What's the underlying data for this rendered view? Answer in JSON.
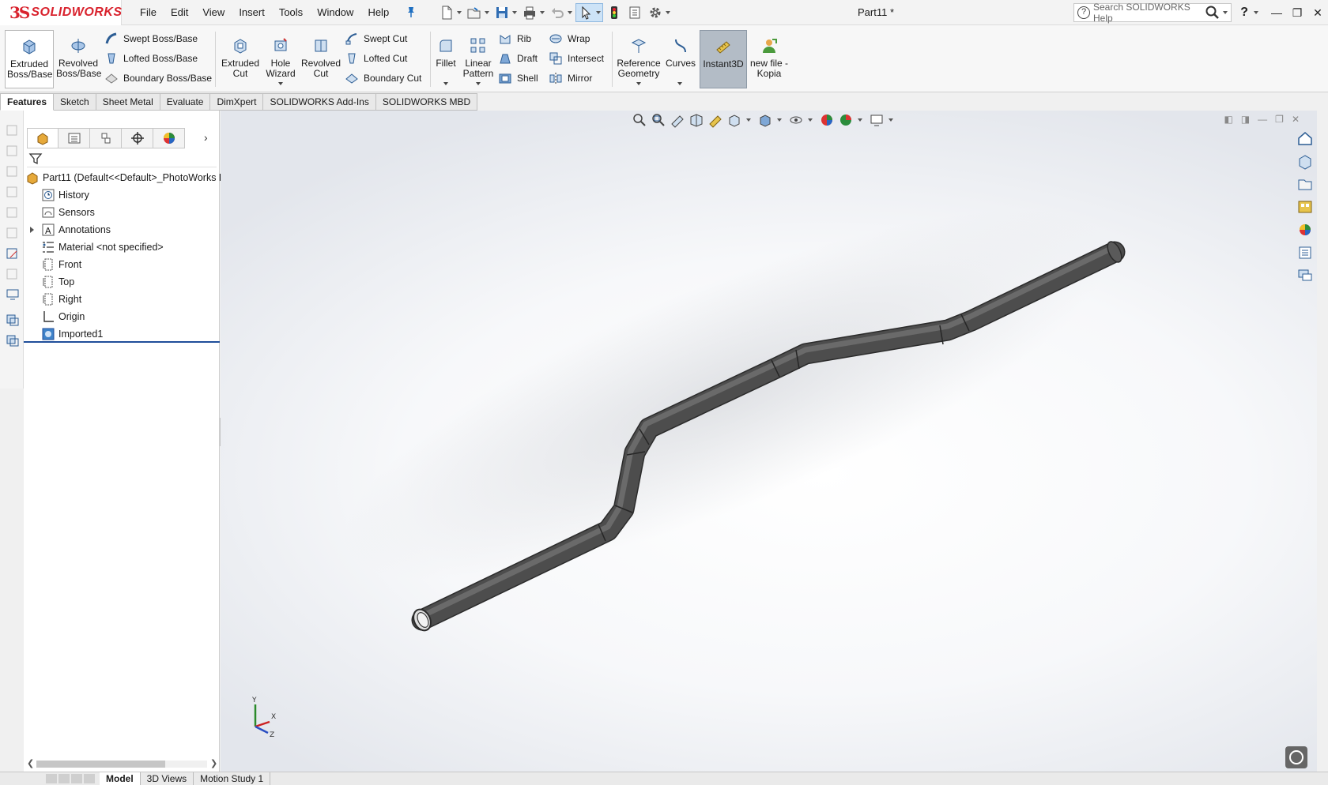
{
  "app": {
    "brand_ds": "3S",
    "brand_name": "SOLIDWORKS",
    "document_title": "Part11 *"
  },
  "menu": [
    "File",
    "Edit",
    "View",
    "Insert",
    "Tools",
    "Window",
    "Help"
  ],
  "search": {
    "placeholder": "Search SOLIDWORKS Help"
  },
  "toolbar": {
    "extruded_boss": "Extruded Boss/Base",
    "revolved_boss": "Revolved Boss/Base",
    "swept_boss": "Swept Boss/Base",
    "lofted_boss": "Lofted Boss/Base",
    "boundary_boss": "Boundary Boss/Base",
    "extruded_cut": "Extruded Cut",
    "hole_wizard": "Hole Wizard",
    "revolved_cut": "Revolved Cut",
    "swept_cut": "Swept Cut",
    "lofted_cut": "Lofted Cut",
    "boundary_cut": "Boundary Cut",
    "fillet": "Fillet",
    "linear_pattern": "Linear Pattern",
    "rib": "Rib",
    "draft": "Draft",
    "shell": "Shell",
    "wrap": "Wrap",
    "intersect": "Intersect",
    "mirror": "Mirror",
    "reference_geometry": "Reference Geometry",
    "curves": "Curves",
    "instant3d": "Instant3D",
    "new_file_kopia": "new file - Kopia"
  },
  "tabs": [
    "Features",
    "Sketch",
    "Sheet Metal",
    "Evaluate",
    "DimXpert",
    "SOLIDWORKS Add-Ins",
    "SOLIDWORKS MBD"
  ],
  "active_tab": "Features",
  "tree": {
    "root": "Part11  (Default<<Default>_PhotoWorks D",
    "items": [
      {
        "label": "History",
        "icon": "history-icon"
      },
      {
        "label": "Sensors",
        "icon": "sensors-icon"
      },
      {
        "label": "Annotations",
        "icon": "annotations-icon"
      },
      {
        "label": "Material <not specified>",
        "icon": "material-icon"
      },
      {
        "label": "Front",
        "icon": "plane-icon"
      },
      {
        "label": "Top",
        "icon": "plane-icon"
      },
      {
        "label": "Right",
        "icon": "plane-icon"
      },
      {
        "label": "Origin",
        "icon": "origin-icon"
      },
      {
        "label": "Imported1",
        "icon": "imported-body-icon"
      }
    ]
  },
  "triad": {
    "x": "X",
    "y": "Y",
    "z": "Z"
  },
  "bottom_tabs": [
    "Model",
    "3D Views",
    "Motion Study 1"
  ],
  "colors": {
    "brand_red": "#d9232e",
    "selection_blue": "#1f4e9a",
    "active_command": "#b3bcc6",
    "tube": "#4d4d4d"
  }
}
